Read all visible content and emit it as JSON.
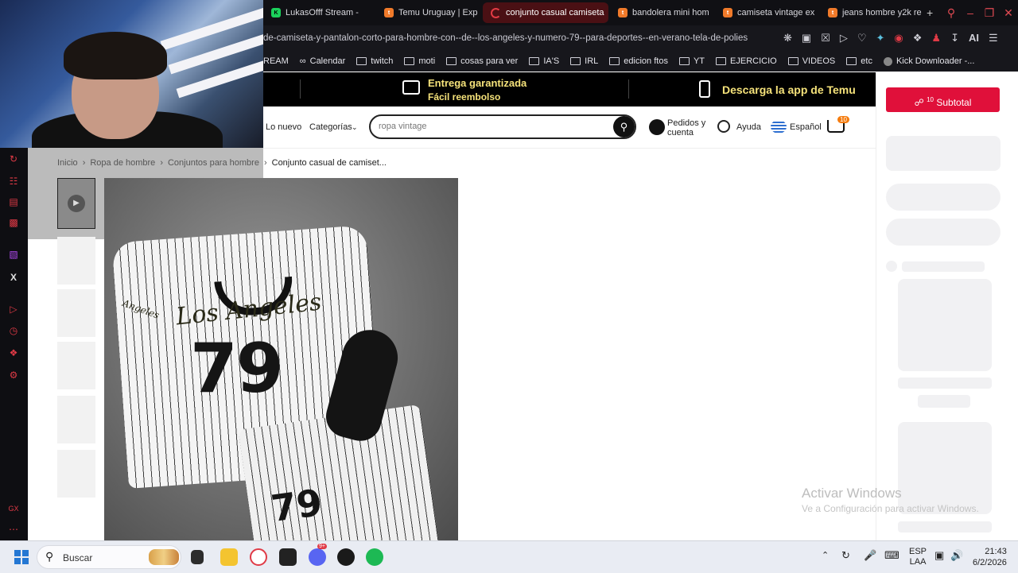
{
  "browser": {
    "tabs": [
      {
        "label": "LukasOfff Stream -",
        "icon": "kick-icon",
        "active": false
      },
      {
        "label": "Temu Uruguay | Exp",
        "icon": "temu-icon",
        "active": false
      },
      {
        "label": "conjunto casual camiseta",
        "icon": "loading-spinner-icon",
        "active": true
      },
      {
        "label": "bandolera mini hom",
        "icon": "temu-icon",
        "active": false
      },
      {
        "label": "camiseta vintage ex",
        "icon": "temu-icon",
        "active": false
      },
      {
        "label": "jeans hombre y2k re",
        "icon": "temu-icon",
        "active": false
      }
    ],
    "new_tab": "+",
    "url": "de-camiseta-y-pantalon-corto-para-hombre-con--de--los-angeles-y-numero-79--para-deportes--en-verano-tela-de-polies",
    "ai_label": "AI",
    "bookmarks": [
      {
        "label": "REAM",
        "icon": "none"
      },
      {
        "label": "Calendar",
        "icon": "infinity-icon"
      },
      {
        "label": "twitch",
        "icon": "folder-icon"
      },
      {
        "label": "moti",
        "icon": "folder-icon"
      },
      {
        "label": "cosas para ver",
        "icon": "folder-icon"
      },
      {
        "label": "IA'S",
        "icon": "folder-icon"
      },
      {
        "label": "IRL",
        "icon": "folder-icon"
      },
      {
        "label": "edicion ftos",
        "icon": "folder-icon"
      },
      {
        "label": "YT",
        "icon": "folder-icon"
      },
      {
        "label": "EJERCICIO",
        "icon": "folder-icon"
      },
      {
        "label": "VIDEOS",
        "icon": "folder-icon"
      },
      {
        "label": "etc",
        "icon": "folder-icon"
      },
      {
        "label": "Kick Downloader -...",
        "icon": "kick-icon"
      }
    ],
    "accent": "#e03a46"
  },
  "promo": {
    "left_title": "Entrega garantizada",
    "left_sub": "Fácil reembolso",
    "right_title": "Descarga la app de Temu",
    "text_color": "#f5e27a"
  },
  "header": {
    "lo_nuevo": "Lo nuevo",
    "categorias": "Categorías",
    "search_value": "ropa vintage",
    "orders_line1": "Pedidos y",
    "orders_line2": "cuenta",
    "help": "Ayuda",
    "language": "Español",
    "cart_count": "10"
  },
  "breadcrumb": {
    "items": [
      "Inicio",
      "Ropa de hombre",
      "Conjuntos para hombre"
    ],
    "current": "Conjunto casual de camiset..."
  },
  "product": {
    "script_text": "Los Angeles",
    "number": "79",
    "sleeve_script": "Angeles"
  },
  "cart_panel": {
    "subtotal_label": "Subtotal",
    "count": "10"
  },
  "watermark": {
    "title": "Activar Windows",
    "sub": "Ve a Configuración para activar Windows."
  },
  "taskbar": {
    "search_placeholder": "Buscar",
    "lang_top": "ESP",
    "lang_bottom": "LAA",
    "time": "21:43",
    "date": "6/2/2026",
    "notification_badge": "9+"
  }
}
